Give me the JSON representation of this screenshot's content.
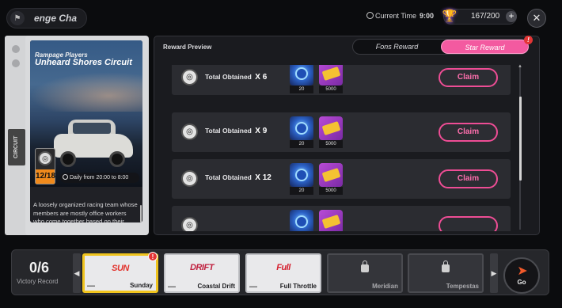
{
  "header": {
    "title": "enge  Cha",
    "current_time_label": "Current Time",
    "current_time_value": "9:00",
    "stamina": "167/200",
    "plus": "+",
    "close": "✕"
  },
  "card": {
    "side_label": "CIRCUIT",
    "subtitle": "Rampage Players",
    "title": "Unheard Shores Circuit",
    "level": "12/18",
    "daily": "Daily from 20:00 to 8:00",
    "description": "A loosely organized racing team whose members are mostly office workers who come together based on their shared interest in racing."
  },
  "panel": {
    "title": "Reward Preview",
    "tabs": [
      {
        "label": "Fons Reward",
        "active": false
      },
      {
        "label": "Star Reward",
        "active": true
      }
    ],
    "tab_alert": "!",
    "rows": [
      {
        "label": "Total Obtained",
        "mult": "X 6",
        "item1_qty": "20",
        "item2_qty": "5000",
        "claim": "Claim"
      },
      {
        "label": "Total Obtained",
        "mult": "X 9",
        "item1_qty": "20",
        "item2_qty": "5000",
        "claim": "Claim"
      },
      {
        "label": "Total Obtained",
        "mult": "X 12",
        "item1_qty": "20",
        "item2_qty": "5000",
        "claim": "Claim"
      }
    ],
    "scroll_up": "▲"
  },
  "bottom": {
    "victory_count": "0/6",
    "victory_label": "Victory Record",
    "tracks": [
      {
        "name": "Sunday",
        "logo": "SUN",
        "selected": true,
        "locked": false
      },
      {
        "name": "Coastal Drift",
        "logo": "DRIFT",
        "selected": false,
        "locked": false
      },
      {
        "name": "Full Throttle",
        "logo": "Full",
        "selected": false,
        "locked": false
      },
      {
        "name": "Meridian",
        "logo": "",
        "selected": false,
        "locked": true
      },
      {
        "name": "Tempestas",
        "logo": "",
        "selected": false,
        "locked": true
      }
    ],
    "track_alert": "!",
    "go_label": "Go",
    "nav_left": "◀",
    "nav_right": "▶"
  },
  "colors": {
    "accent_pink": "#f35aa0",
    "claim_border": "#ee4d95",
    "level_orange": "#f08a1c",
    "selected_yellow": "#f0c41e",
    "go_orange": "#f1592a"
  }
}
